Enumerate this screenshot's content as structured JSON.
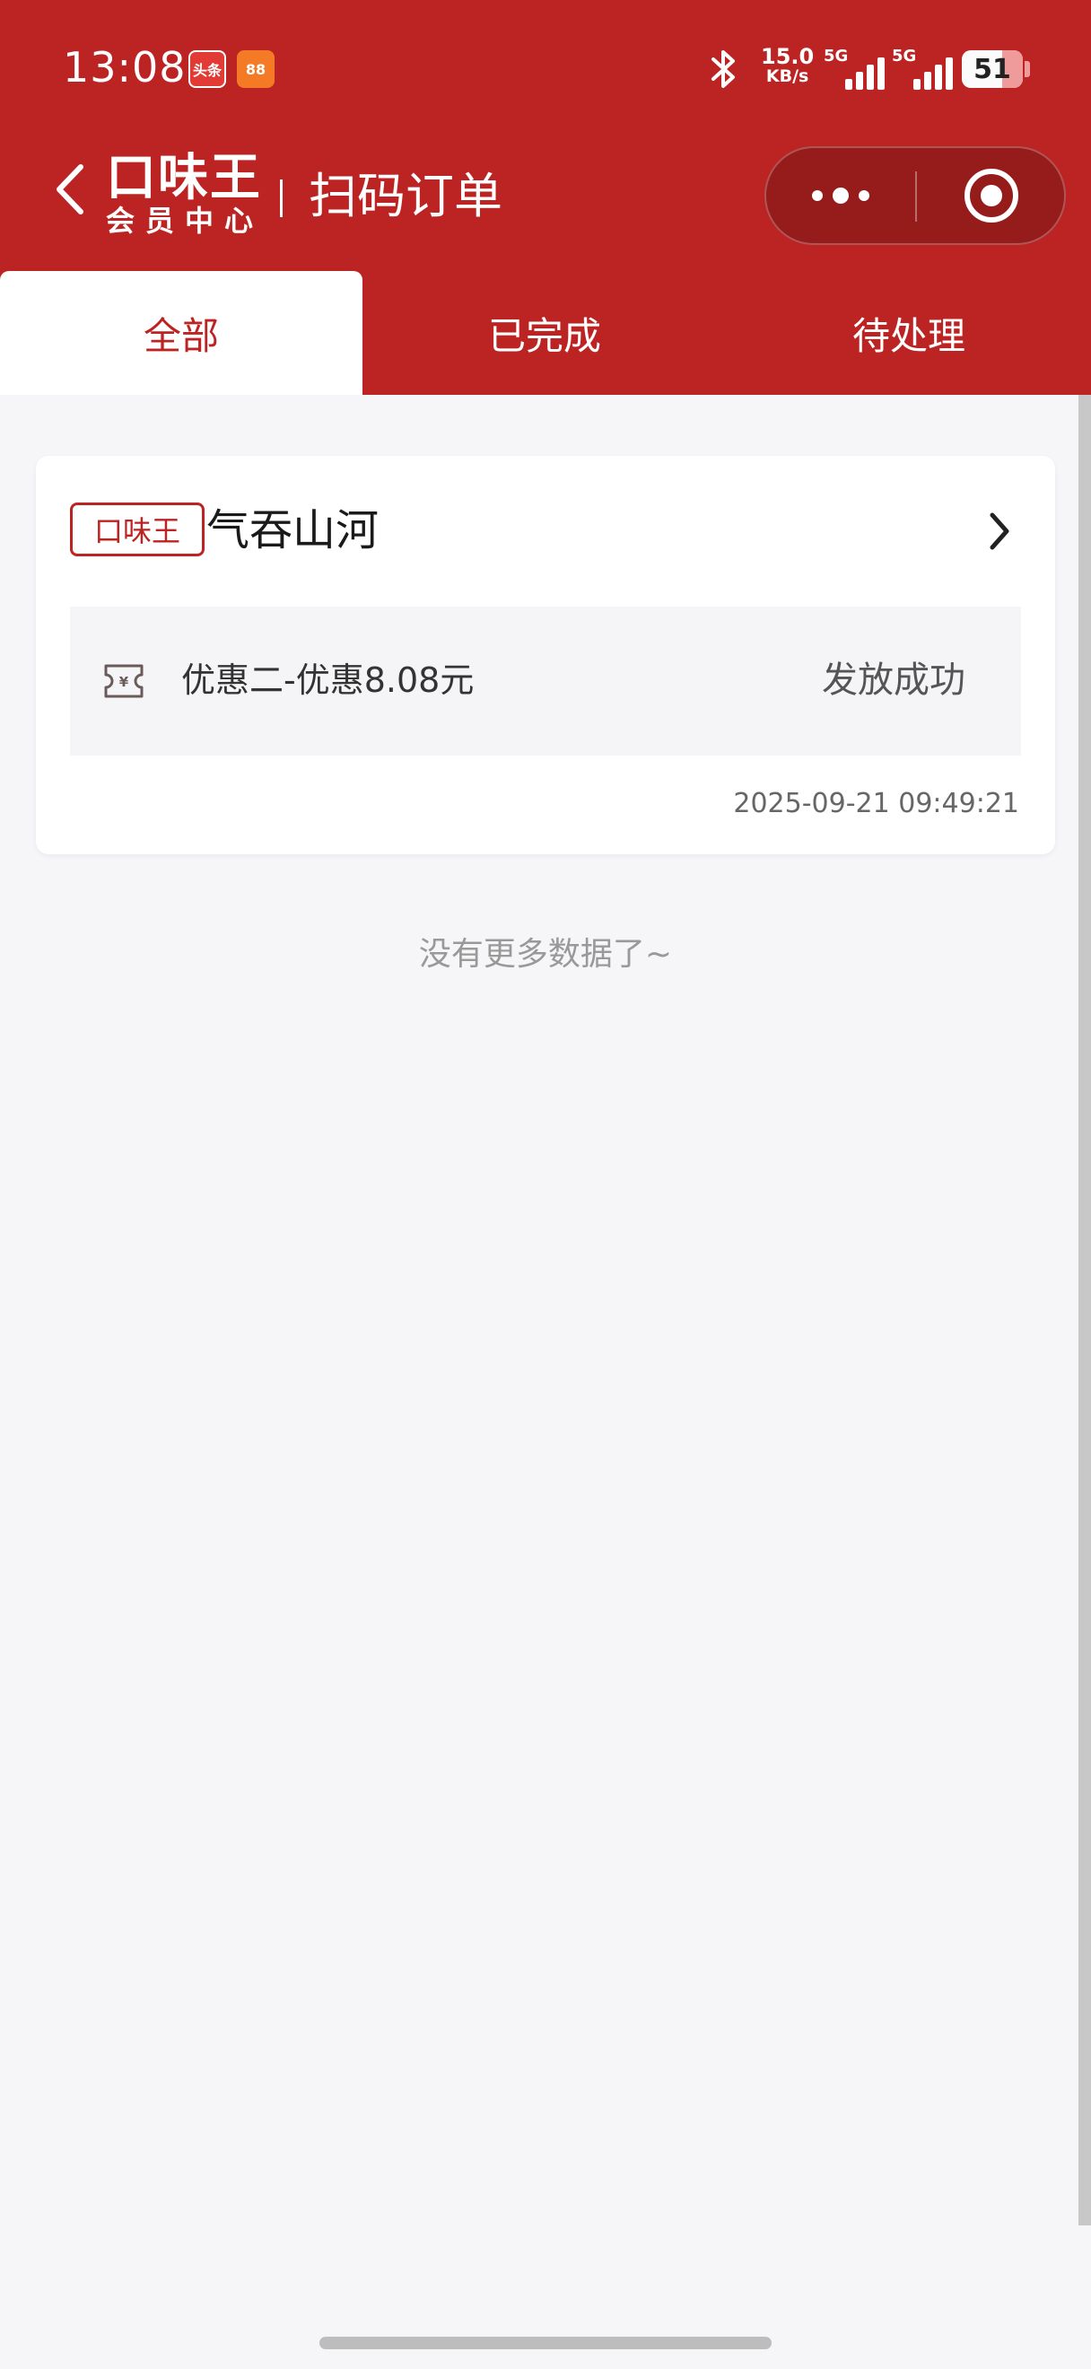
{
  "status_bar": {
    "time": "13:08",
    "app_badges": [
      "头条",
      "88"
    ],
    "net_speed_value": "15.0",
    "net_speed_unit": "KB/s",
    "network_1": "5G",
    "network_2": "5G",
    "battery_level": "51"
  },
  "nav": {
    "logo_main": "口味王",
    "logo_sub": "会员中心",
    "title": "扫码订单"
  },
  "tabs": [
    {
      "label": "全部",
      "active": true
    },
    {
      "label": "已完成",
      "active": false
    },
    {
      "label": "待处理",
      "active": false
    }
  ],
  "orders": [
    {
      "brand_tag": "口味王",
      "store_name": "气吞山河",
      "coupon_name": "优惠二-优惠8.08元",
      "coupon_status": "发放成功",
      "time": "2025-09-21 09:49:21"
    }
  ],
  "footer_text": "没有更多数据了~",
  "colors": {
    "brand_red": "#bc2423",
    "background": "#f6f6f8",
    "card": "#ffffff"
  }
}
